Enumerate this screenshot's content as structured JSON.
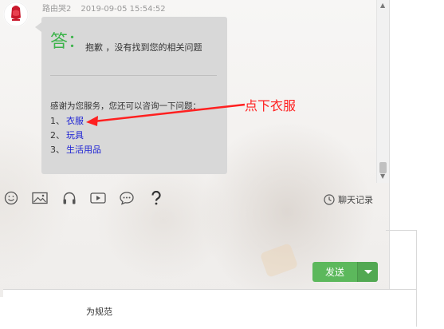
{
  "message": {
    "sender_name": "路由哭2",
    "timestamp": "2019-09-05 15:54:52",
    "answer_label": "答：",
    "answer_text": "抱歉 ，没有找到您的相关问题",
    "intro": "感谢为您服务，您还可以咨询一下问题：",
    "options": [
      {
        "index": "1、",
        "label": "衣服"
      },
      {
        "index": "2、",
        "label": "玩具"
      },
      {
        "index": "3、",
        "label": "生活用品"
      }
    ]
  },
  "annotation": {
    "label": "点下衣服",
    "color": "#ff2020"
  },
  "toolbar": {
    "icons": [
      "emoji-icon",
      "image-icon",
      "headphones-icon",
      "video-icon",
      "chat-bubble-icon",
      "question-icon"
    ],
    "history_label": "聊天记录"
  },
  "composer": {
    "send_label": "发送"
  },
  "footer": {
    "text": "为规范"
  },
  "colors": {
    "answer_green": "#3cb34a",
    "link_blue": "#1a1fd4",
    "send_green": "#5cb85c",
    "bubble_gray": "#d8d8d8"
  }
}
